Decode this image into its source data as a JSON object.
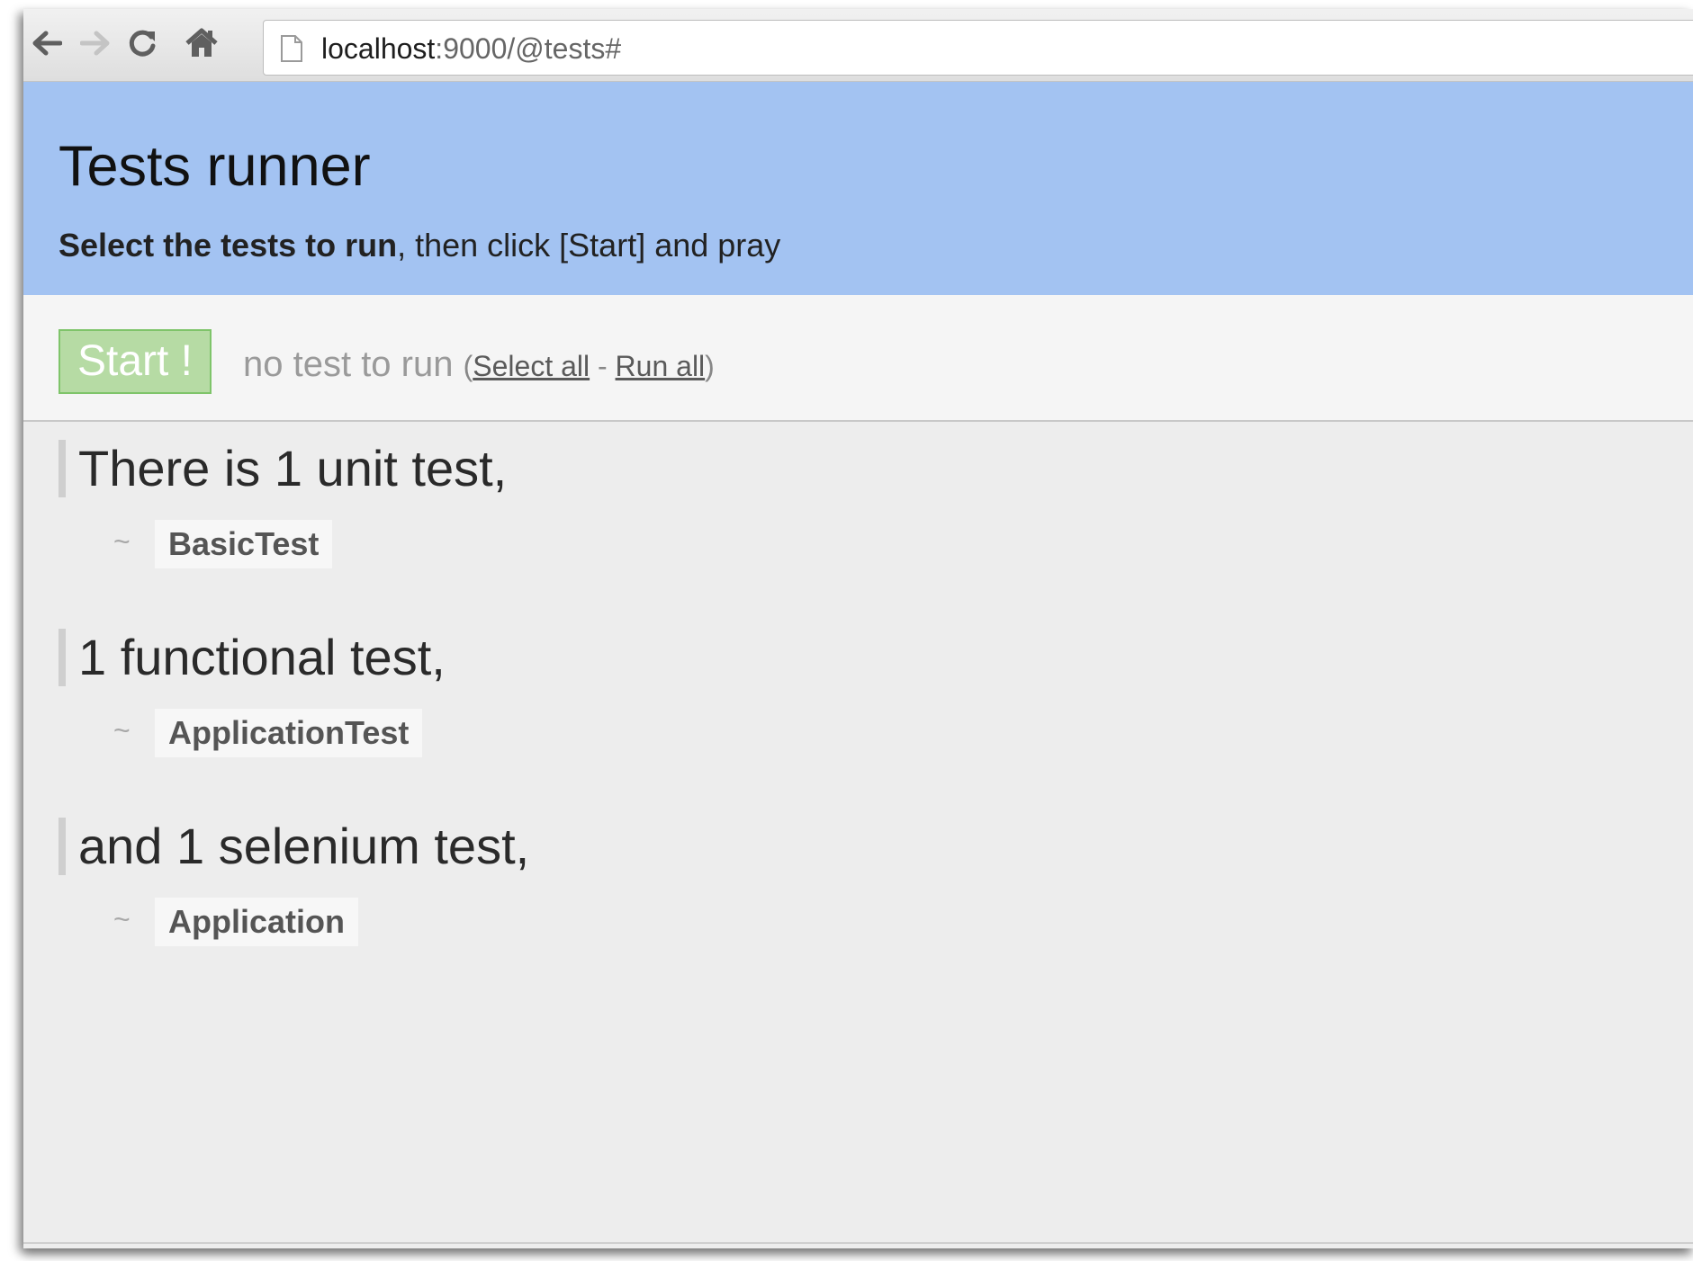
{
  "browser": {
    "url_host": "localhost",
    "url_path": ":9000/@tests#"
  },
  "header": {
    "title": "Tests runner",
    "subtitle_bold": "Select the tests to run",
    "subtitle_rest": ", then click [Start] and pray"
  },
  "toolbar": {
    "start_label": "Start !",
    "status": "no test to run",
    "paren_open": "(",
    "select_all": "Select all",
    "separator": " - ",
    "run_all": "Run all",
    "paren_close": ")"
  },
  "sections": [
    {
      "heading": "There is 1 unit test,",
      "bullet": "~",
      "tests": [
        "BasicTest"
      ]
    },
    {
      "heading": "1 functional test,",
      "bullet": "~",
      "tests": [
        "ApplicationTest"
      ]
    },
    {
      "heading": "and 1 selenium test,",
      "bullet": "~",
      "tests": [
        "Application"
      ]
    }
  ],
  "icons": {
    "back": "back-arrow-icon",
    "forward": "forward-arrow-icon",
    "reload": "reload-icon",
    "home": "home-icon",
    "page": "page-icon"
  },
  "colors": {
    "header_bg": "#a3c3f2",
    "start_bg": "#b6dba4",
    "start_border": "#7fc46a"
  }
}
